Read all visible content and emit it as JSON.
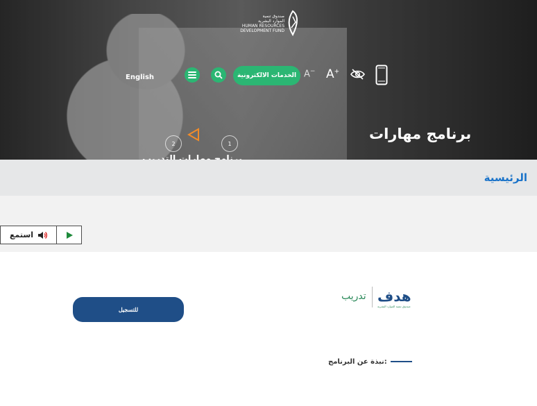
{
  "header": {
    "logo_text": [
      "صندوق تنمية",
      "الموارد البشرية",
      "HUMAN RESOURCES",
      "DEVELOPMENT FUND"
    ],
    "language_link": "English",
    "eservices_label": "الخدمات الالكترونية",
    "font_decrease_label": "A",
    "font_increase_label": "A",
    "font_decrease_sign": "−",
    "font_increase_sign": "+"
  },
  "hero": {
    "title": "برنامج مهارات",
    "slides": [
      "1",
      "2"
    ],
    "caption": "برنامج مهارات التدريب"
  },
  "breadcrumb": {
    "current": "الرئيسية"
  },
  "listen": {
    "label": "استمع"
  },
  "program": {
    "register_label": "للتسجيل",
    "partner_tag": "تدريب",
    "partner_brand": "هدف",
    "partner_brand_sub": "صندوق تنمية الموارد البشرية",
    "about_heading": "نبذة عن البرنامج:"
  },
  "colors": {
    "accent_green": "#2bb673",
    "brand_blue": "#1f4e87",
    "link_blue": "#1a73c9",
    "breadcrumb_bg": "#e6e7e8",
    "slider_orange": "#f28c28"
  }
}
